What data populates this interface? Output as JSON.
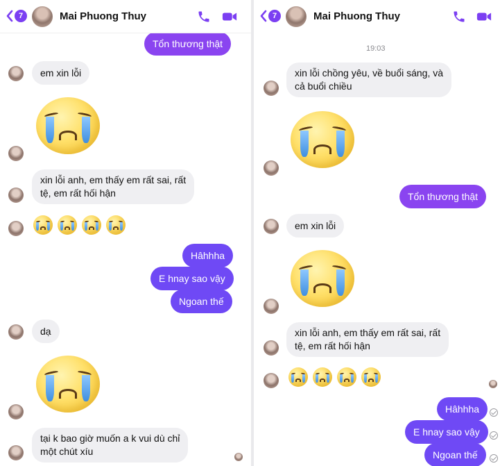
{
  "header": {
    "back_count": "7",
    "contact_name": "Mai Phuong Thuy",
    "call_icon": "phone-icon",
    "video_icon": "video-camera-icon",
    "accent": "#7b3ff2"
  },
  "left": {
    "messages": [
      {
        "text": "Tổn thương thật"
      },
      {
        "text": "em xin lỗi"
      },
      {
        "text": "xin lỗi anh, em thấy em rất sai, rất"
      },
      {
        "text": "tệ, em rất hối hận"
      },
      {
        "text": "Hâhhha"
      },
      {
        "text": "E hnay sao vậy"
      },
      {
        "text": "Ngoan thế"
      },
      {
        "text": "dạ"
      },
      {
        "text": "tại k bao giờ muốn a k vui dù chỉ"
      },
      {
        "text": "một chút xíu"
      }
    ]
  },
  "right": {
    "timestamp": "19:03",
    "messages": [
      {
        "text": "xin lỗi chồng yêu, về buổi sáng, và"
      },
      {
        "text": "cả buổi chiều"
      },
      {
        "text": "Tổn thương thật"
      },
      {
        "text": "em xin lỗi"
      },
      {
        "text": "xin lỗi anh, em thấy em rất sai, rất"
      },
      {
        "text": "tệ, em rất hối hận"
      },
      {
        "text": "Hâhhha"
      },
      {
        "text": "E hnay sao vậy"
      },
      {
        "text": "Ngoan thế"
      }
    ]
  },
  "colors": {
    "outgoing_bubble": "#6f49f5",
    "outgoing_bubble_alt": "#8a44f0",
    "incoming_bubble": "#efeff2"
  }
}
